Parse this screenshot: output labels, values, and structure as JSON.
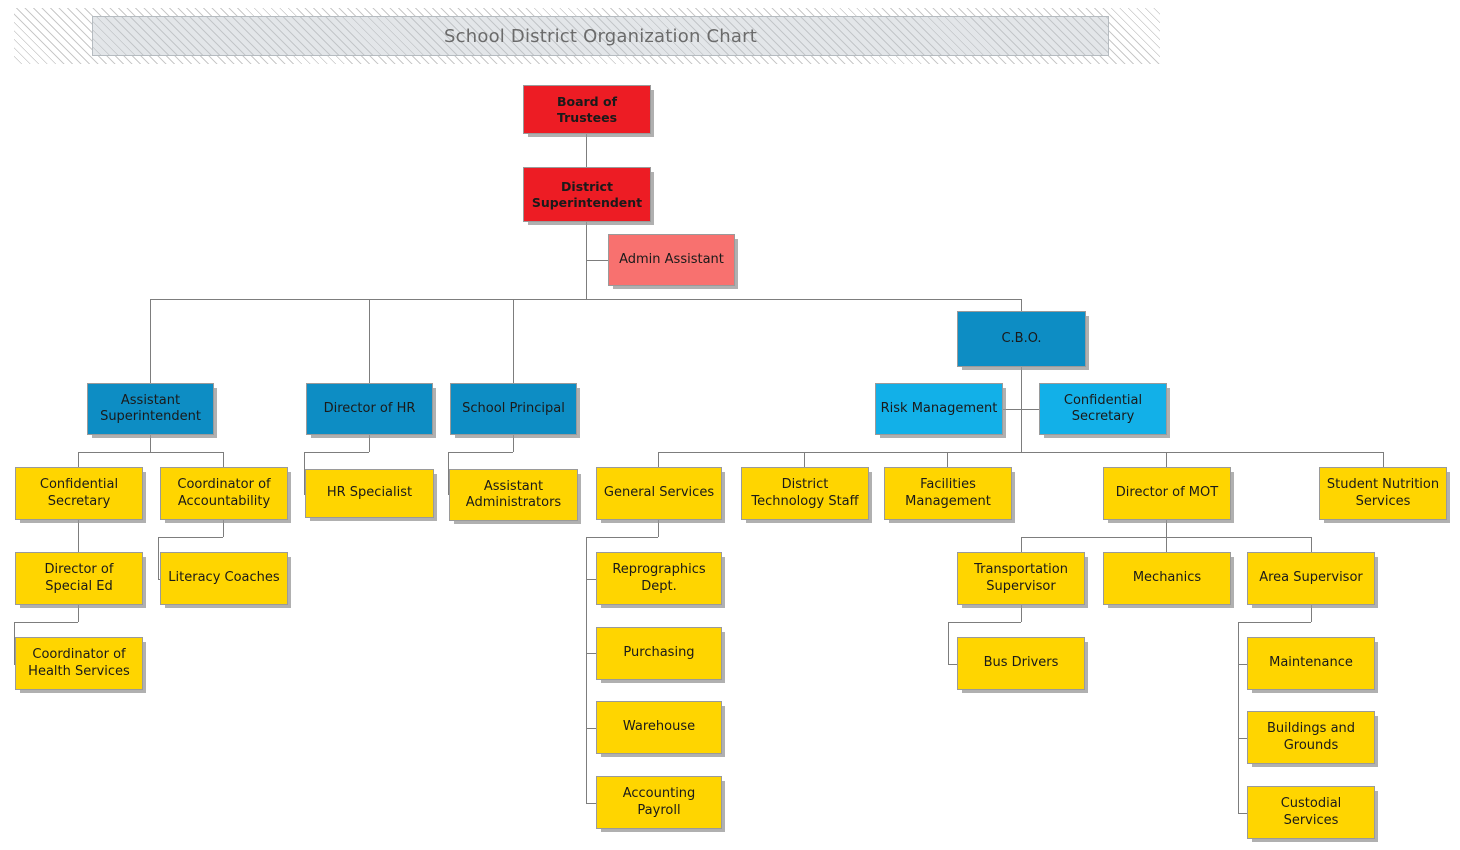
{
  "title": {
    "text": "School District Organization Chart"
  },
  "chart_data": {
    "type": "diagram",
    "diagram_type": "organization-chart",
    "title": "School District Organization Chart",
    "legend_colors": {
      "executive_red": "#ED1C24",
      "assistant_salmon": "#F8716F",
      "director_blue_dark": "#0D8DC4",
      "support_blue_light": "#12B0E8",
      "department_yellow": "#FFD500",
      "connector_gray": "#7D7D7D",
      "title_band_gray": "#D4D9DD"
    },
    "nodes": [
      {
        "id": "board",
        "label": "Board of Trustees",
        "level": 0,
        "color": "executive_red"
      },
      {
        "id": "supt",
        "label": "District Superintendent",
        "level": 1,
        "color": "executive_red"
      },
      {
        "id": "admin",
        "label": "Admin Assistant",
        "level": 2,
        "color": "assistant_salmon"
      },
      {
        "id": "asst_supt",
        "label": "Assistant Superintendent",
        "level": 2,
        "color": "director_blue_dark"
      },
      {
        "id": "dir_hr",
        "label": "Director of HR",
        "level": 2,
        "color": "director_blue_dark"
      },
      {
        "id": "principal",
        "label": "School Principal",
        "level": 2,
        "color": "director_blue_dark"
      },
      {
        "id": "cbo",
        "label": "C.B.O.",
        "level": 2,
        "color": "director_blue_dark"
      },
      {
        "id": "risk",
        "label": "Risk Management",
        "level": 3,
        "color": "support_blue_light"
      },
      {
        "id": "conf_sec_cbo",
        "label": "Confidential Secretary",
        "level": 3,
        "color": "support_blue_light"
      },
      {
        "id": "conf_sec",
        "label": "Confidential Secretary",
        "level": 3,
        "color": "department_yellow"
      },
      {
        "id": "coord_acct",
        "label": "Coordinator of Accountability",
        "level": 3,
        "color": "department_yellow"
      },
      {
        "id": "hr_spec",
        "label": "HR Specialist",
        "level": 3,
        "color": "department_yellow"
      },
      {
        "id": "asst_admins",
        "label": "Assistant Administrators",
        "level": 3,
        "color": "department_yellow"
      },
      {
        "id": "gen_serv",
        "label": "General Services",
        "level": 3,
        "color": "department_yellow"
      },
      {
        "id": "dist_tech",
        "label": "District Technology Staff",
        "level": 3,
        "color": "department_yellow"
      },
      {
        "id": "facilities",
        "label": "Facilities Management",
        "level": 3,
        "color": "department_yellow"
      },
      {
        "id": "dir_mot",
        "label": "Director of MOT",
        "level": 3,
        "color": "department_yellow"
      },
      {
        "id": "nutrition",
        "label": "Student Nutrition Services",
        "level": 3,
        "color": "department_yellow"
      },
      {
        "id": "dir_sped",
        "label": "Director of Special Ed",
        "level": 4,
        "color": "department_yellow"
      },
      {
        "id": "literacy",
        "label": "Literacy Coaches",
        "level": 4,
        "color": "department_yellow"
      },
      {
        "id": "repro",
        "label": "Reprographics Dept.",
        "level": 4,
        "color": "department_yellow"
      },
      {
        "id": "purchasing",
        "label": "Purchasing",
        "level": 4,
        "color": "department_yellow"
      },
      {
        "id": "warehouse",
        "label": "Warehouse",
        "level": 4,
        "color": "department_yellow"
      },
      {
        "id": "accounting",
        "label": "Accounting Payroll",
        "level": 4,
        "color": "department_yellow"
      },
      {
        "id": "transport",
        "label": "Transportation Supervisor",
        "level": 4,
        "color": "department_yellow"
      },
      {
        "id": "mechanics",
        "label": "Mechanics",
        "level": 4,
        "color": "department_yellow"
      },
      {
        "id": "area_sup",
        "label": "Area Supervisor",
        "level": 4,
        "color": "department_yellow"
      },
      {
        "id": "health",
        "label": "Coordinator of Health Services",
        "level": 5,
        "color": "department_yellow"
      },
      {
        "id": "bus_drivers",
        "label": "Bus Drivers",
        "level": 5,
        "color": "department_yellow"
      },
      {
        "id": "maintenance",
        "label": "Maintenance",
        "level": 5,
        "color": "department_yellow"
      },
      {
        "id": "buildings",
        "label": "Buildings and Grounds",
        "level": 5,
        "color": "department_yellow"
      },
      {
        "id": "custodial",
        "label": "Custodial Services",
        "level": 5,
        "color": "department_yellow"
      }
    ],
    "edges": [
      {
        "from": "board",
        "to": "supt"
      },
      {
        "from": "supt",
        "to": "admin"
      },
      {
        "from": "supt",
        "to": "asst_supt"
      },
      {
        "from": "supt",
        "to": "dir_hr"
      },
      {
        "from": "supt",
        "to": "principal"
      },
      {
        "from": "supt",
        "to": "cbo"
      },
      {
        "from": "cbo",
        "to": "risk"
      },
      {
        "from": "cbo",
        "to": "conf_sec_cbo"
      },
      {
        "from": "cbo",
        "to": "gen_serv"
      },
      {
        "from": "cbo",
        "to": "dist_tech"
      },
      {
        "from": "cbo",
        "to": "facilities"
      },
      {
        "from": "cbo",
        "to": "dir_mot"
      },
      {
        "from": "cbo",
        "to": "nutrition"
      },
      {
        "from": "asst_supt",
        "to": "conf_sec"
      },
      {
        "from": "asst_supt",
        "to": "coord_acct"
      },
      {
        "from": "dir_hr",
        "to": "hr_spec"
      },
      {
        "from": "principal",
        "to": "asst_admins"
      },
      {
        "from": "conf_sec",
        "to": "dir_sped"
      },
      {
        "from": "coord_acct",
        "to": "literacy"
      },
      {
        "from": "dir_sped",
        "to": "health"
      },
      {
        "from": "gen_serv",
        "to": "repro"
      },
      {
        "from": "gen_serv",
        "to": "purchasing"
      },
      {
        "from": "gen_serv",
        "to": "warehouse"
      },
      {
        "from": "gen_serv",
        "to": "accounting"
      },
      {
        "from": "dir_mot",
        "to": "transport"
      },
      {
        "from": "dir_mot",
        "to": "mechanics"
      },
      {
        "from": "dir_mot",
        "to": "area_sup"
      },
      {
        "from": "transport",
        "to": "bus_drivers"
      },
      {
        "from": "area_sup",
        "to": "maintenance"
      },
      {
        "from": "area_sup",
        "to": "buildings"
      },
      {
        "from": "area_sup",
        "to": "custodial"
      }
    ]
  },
  "nodes": {
    "board": "Board of Trustees",
    "supt": "District Superintendent",
    "admin": "Admin Assistant",
    "asst_supt": "Assistant Superintendent",
    "dir_hr": "Director of HR",
    "principal": "School Principal",
    "cbo": "C.B.O.",
    "risk": "Risk Management",
    "conf_sec_cbo": "Confidential Secretary",
    "conf_sec": "Confidential Secretary",
    "coord_acct": "Coordinator of Accountability",
    "hr_spec": "HR Specialist",
    "asst_admins": "Assistant Administrators",
    "gen_serv": "General Services",
    "dist_tech": "District Technology Staff",
    "facilities": "Facilities Management",
    "dir_mot": "Director of MOT",
    "nutrition": "Student Nutrition Services",
    "dir_sped": "Director of Special Ed",
    "literacy": "Literacy Coaches",
    "repro": "Reprographics Dept.",
    "purchasing": "Purchasing",
    "warehouse": "Warehouse",
    "accounting": "Accounting Payroll",
    "transport": "Transportation Supervisor",
    "mechanics": "Mechanics",
    "area_sup": "Area Supervisor",
    "health": "Coordinator of Health Services",
    "bus_drivers": "Bus Drivers",
    "maintenance": "Maintenance",
    "buildings": "Buildings and Grounds",
    "custodial": "Custodial Services"
  }
}
